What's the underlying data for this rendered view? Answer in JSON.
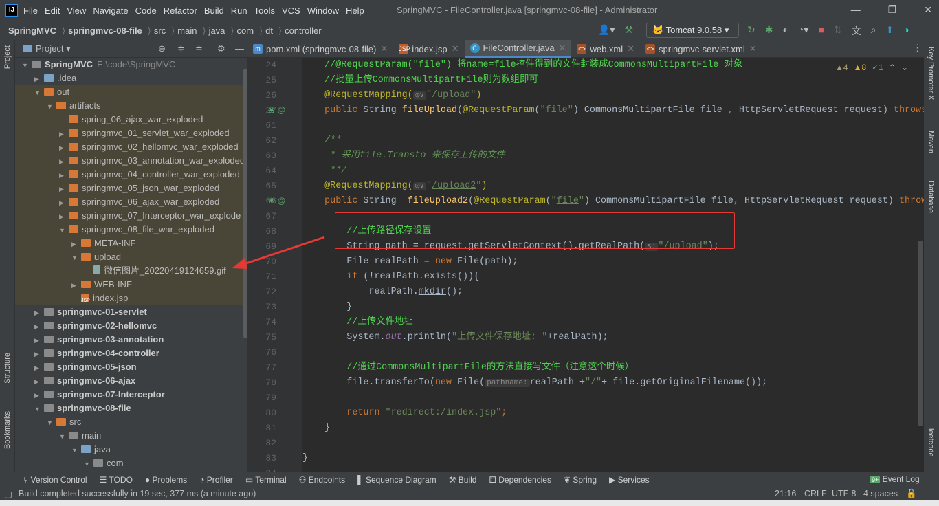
{
  "menu": {
    "items": [
      "File",
      "Edit",
      "View",
      "Navigate",
      "Code",
      "Refactor",
      "Build",
      "Run",
      "Tools",
      "VCS",
      "Window",
      "Help"
    ],
    "window_title": "SpringMVC - FileController.java [springmvc-08-file] - Administrator"
  },
  "breadcrumb": [
    "SpringMVC",
    "springmvc-08-file",
    "src",
    "main",
    "java",
    "com",
    "dt",
    "controller"
  ],
  "run_config": "Tomcat 9.0.58",
  "project": {
    "title": "Project",
    "tree": [
      {
        "d": 0,
        "a": "v",
        "i": "g",
        "t": "SpringMVC",
        "x": "E:\\code\\SpringMVC",
        "b": true
      },
      {
        "d": 1,
        "a": ">",
        "i": "b",
        "t": ".idea"
      },
      {
        "d": 1,
        "a": "v",
        "i": "o",
        "t": "out",
        "h": true
      },
      {
        "d": 2,
        "a": "v",
        "i": "o",
        "t": "artifacts",
        "h": true
      },
      {
        "d": 3,
        "a": "",
        "i": "o",
        "t": "spring_06_ajax_war_exploded",
        "h": true
      },
      {
        "d": 3,
        "a": ">",
        "i": "o",
        "t": "springmvc_01_servlet_war_exploded",
        "h": true
      },
      {
        "d": 3,
        "a": ">",
        "i": "o",
        "t": "springmvc_02_hellomvc_war_exploded",
        "h": true
      },
      {
        "d": 3,
        "a": ">",
        "i": "o",
        "t": "springmvc_03_annotation_war_explodec",
        "h": true
      },
      {
        "d": 3,
        "a": ">",
        "i": "o",
        "t": "springmvc_04_controller_war_exploded",
        "h": true
      },
      {
        "d": 3,
        "a": ">",
        "i": "o",
        "t": "springmvc_05_json_war_exploded",
        "h": true
      },
      {
        "d": 3,
        "a": ">",
        "i": "o",
        "t": "springmvc_06_ajax_war_exploded",
        "h": true
      },
      {
        "d": 3,
        "a": ">",
        "i": "o",
        "t": "springmvc_07_Interceptor_war_explode",
        "h": true
      },
      {
        "d": 3,
        "a": "v",
        "i": "o",
        "t": "springmvc_08_file_war_exploded",
        "h": true
      },
      {
        "d": 4,
        "a": ">",
        "i": "o",
        "t": "META-INF",
        "h": true
      },
      {
        "d": 4,
        "a": "v",
        "i": "o",
        "t": "upload",
        "h": true
      },
      {
        "d": 5,
        "a": "",
        "i": "f",
        "t": "微信图片_20220419124659.gif",
        "h": true
      },
      {
        "d": 4,
        "a": ">",
        "i": "o",
        "t": "WEB-INF",
        "h": true
      },
      {
        "d": 4,
        "a": "",
        "i": "j",
        "t": "index.jsp",
        "h": true
      },
      {
        "d": 1,
        "a": ">",
        "i": "g",
        "t": "springmvc-01-servlet",
        "b": true
      },
      {
        "d": 1,
        "a": ">",
        "i": "g",
        "t": "springmvc-02-hellomvc",
        "b": true
      },
      {
        "d": 1,
        "a": ">",
        "i": "g",
        "t": "springmvc-03-annotation",
        "b": true
      },
      {
        "d": 1,
        "a": ">",
        "i": "g",
        "t": "springmvc-04-controller",
        "b": true
      },
      {
        "d": 1,
        "a": ">",
        "i": "g",
        "t": "springmvc-05-json",
        "b": true
      },
      {
        "d": 1,
        "a": ">",
        "i": "g",
        "t": "springmvc-06-ajax",
        "b": true
      },
      {
        "d": 1,
        "a": ">",
        "i": "g",
        "t": "springmvc-07-Interceptor",
        "b": true
      },
      {
        "d": 1,
        "a": "v",
        "i": "g",
        "t": "springmvc-08-file",
        "b": true
      },
      {
        "d": 2,
        "a": "v",
        "i": "o2",
        "t": "src"
      },
      {
        "d": 3,
        "a": "v",
        "i": "g",
        "t": "main"
      },
      {
        "d": 4,
        "a": "v",
        "i": "b",
        "t": "java"
      },
      {
        "d": 5,
        "a": "v",
        "i": "g",
        "t": "com"
      }
    ]
  },
  "tabs": [
    {
      "label": "pom.xml (springmvc-08-file)",
      "icon": "m"
    },
    {
      "label": "index.jsp",
      "icon": "jsp"
    },
    {
      "label": "FileController.java",
      "icon": "c",
      "active": true
    },
    {
      "label": "web.xml",
      "icon": "xml"
    },
    {
      "label": "springmvc-servlet.xml",
      "icon": "xml"
    }
  ],
  "inspections": {
    "weak_warnings": "4",
    "warnings": "8",
    "typos": "1"
  },
  "code": [
    {
      "n": "24",
      "t": [
        [
          "    //@RequestParam(\"file\") 将name=file控件得到的文件封装成CommonsMultipartFile 对象",
          "c"
        ]
      ]
    },
    {
      "n": "25",
      "t": [
        [
          "    //批量上传CommonsMultipartFile则为数组即可",
          "c"
        ]
      ]
    },
    {
      "n": "26",
      "t": [
        [
          "    @RequestMapping(",
          "a"
        ],
        [
          "◎∨",
          "hint"
        ],
        [
          "\"",
          "s"
        ],
        [
          "/upload",
          "s u"
        ],
        [
          "\"",
          "s"
        ],
        [
          ")",
          "a"
        ]
      ]
    },
    {
      "n": "27",
      "t": [
        [
          "    public ",
          "k"
        ],
        [
          "String ",
          ""
        ],
        [
          "fileUpload",
          "f"
        ],
        [
          "(",
          ""
        ],
        [
          "@RequestParam",
          "a"
        ],
        [
          "(",
          ""
        ],
        [
          "\"",
          "s"
        ],
        [
          "file",
          "s u"
        ],
        [
          "\"",
          "s"
        ],
        [
          ") CommonsMultipartFile file ",
          ""
        ],
        [
          ", ",
          "k"
        ],
        [
          "HttpServletRequest request) ",
          ""
        ],
        [
          "throws",
          "k"
        ]
      ]
    },
    {
      "n": "61",
      "t": []
    },
    {
      "n": "62",
      "t": [
        [
          "    /**",
          "d"
        ]
      ]
    },
    {
      "n": "63",
      "t": [
        [
          "     * 采用",
          "d"
        ],
        [
          "file.Transto",
          "d"
        ],
        [
          " 来保存上传的文件",
          "d"
        ]
      ]
    },
    {
      "n": "64",
      "t": [
        [
          "     **/",
          "d"
        ]
      ]
    },
    {
      "n": "65",
      "t": [
        [
          "    @RequestMapping(",
          "a"
        ],
        [
          "◎∨",
          "hint"
        ],
        [
          "\"",
          "s"
        ],
        [
          "/upload2",
          "s u"
        ],
        [
          "\"",
          "s"
        ],
        [
          ")",
          "a"
        ]
      ]
    },
    {
      "n": "66",
      "t": [
        [
          "    public ",
          "k"
        ],
        [
          "String  ",
          ""
        ],
        [
          "fileUpload2",
          "f"
        ],
        [
          "(",
          ""
        ],
        [
          "@RequestParam",
          "a"
        ],
        [
          "(",
          ""
        ],
        [
          "\"",
          "s"
        ],
        [
          "file",
          "s u"
        ],
        [
          "\"",
          "s"
        ],
        [
          ") CommonsMultipartFile file",
          ""
        ],
        [
          ", ",
          "k"
        ],
        [
          "HttpServletRequest request) ",
          ""
        ],
        [
          "throws",
          "k"
        ]
      ]
    },
    {
      "n": "67",
      "t": []
    },
    {
      "n": "68",
      "t": [
        [
          "        //上传路径保存设置",
          "c"
        ]
      ]
    },
    {
      "n": "69",
      "t": [
        [
          "        String path = request.getServletContext().getRealPath(",
          ""
        ],
        [
          "s:",
          "hint"
        ],
        [
          "\"/upload\"",
          "s"
        ],
        [
          ");",
          ""
        ]
      ]
    },
    {
      "n": "70",
      "t": [
        [
          "        File realPath = ",
          ""
        ],
        [
          "new ",
          "k"
        ],
        [
          "File(path);",
          ""
        ]
      ]
    },
    {
      "n": "71",
      "t": [
        [
          "        ",
          "k"
        ],
        [
          "if ",
          "k"
        ],
        [
          "(!realPath.exists()){",
          ""
        ]
      ]
    },
    {
      "n": "72",
      "t": [
        [
          "            realPath.",
          ""
        ],
        [
          "mkdir",
          "u"
        ],
        [
          "();",
          ""
        ]
      ]
    },
    {
      "n": "73",
      "t": [
        [
          "        }",
          ""
        ]
      ]
    },
    {
      "n": "74",
      "t": [
        [
          "        //上传文件地址",
          "c"
        ]
      ]
    },
    {
      "n": "75",
      "t": [
        [
          "        System.",
          ""
        ],
        [
          "out",
          "i"
        ],
        [
          ".println(",
          ""
        ],
        [
          "\"上传文件保存地址: \"",
          "s"
        ],
        [
          "+realPath);",
          ""
        ]
      ]
    },
    {
      "n": "76",
      "t": []
    },
    {
      "n": "77",
      "t": [
        [
          "        //通过CommonsMultipartFile的方法直接写文件（注意这个时候）",
          "c"
        ]
      ]
    },
    {
      "n": "78",
      "t": [
        [
          "        file.transferTo(",
          ""
        ],
        [
          "new ",
          "k"
        ],
        [
          "File(",
          ""
        ],
        [
          "pathname:",
          "hint"
        ],
        [
          "realPath +",
          ""
        ],
        [
          "\"/\"",
          "s"
        ],
        [
          "+ file.getOriginalFilename());",
          ""
        ]
      ]
    },
    {
      "n": "79",
      "t": []
    },
    {
      "n": "80",
      "t": [
        [
          "        ",
          "k"
        ],
        [
          "return ",
          "k"
        ],
        [
          "\"redirect:/index.jsp\"",
          "s"
        ],
        [
          ";",
          "k"
        ]
      ]
    },
    {
      "n": "81",
      "t": [
        [
          "    }",
          ""
        ]
      ]
    },
    {
      "n": "82",
      "t": []
    },
    {
      "n": "83",
      "t": [
        [
          "}",
          ""
        ]
      ]
    },
    {
      "n": "84",
      "t": []
    }
  ],
  "left_strip": [
    "Project",
    "Structure",
    "Bookmarks"
  ],
  "right_strip": [
    "Key Promoter X",
    "Maven",
    "Database",
    "leetcode"
  ],
  "bottom_tools": [
    "Version Control",
    "TODO",
    "Problems",
    "Profiler",
    "Terminal",
    "Endpoints",
    "Sequence Diagram",
    "Build",
    "Dependencies",
    "Spring",
    "Services"
  ],
  "event_log": "Event Log",
  "status": {
    "message": "Build completed successfully in 19 sec, 377 ms (a minute ago)",
    "position": "21:16",
    "line_sep": "CRLF",
    "encoding": "UTF-8",
    "indent": "4 spaces"
  }
}
